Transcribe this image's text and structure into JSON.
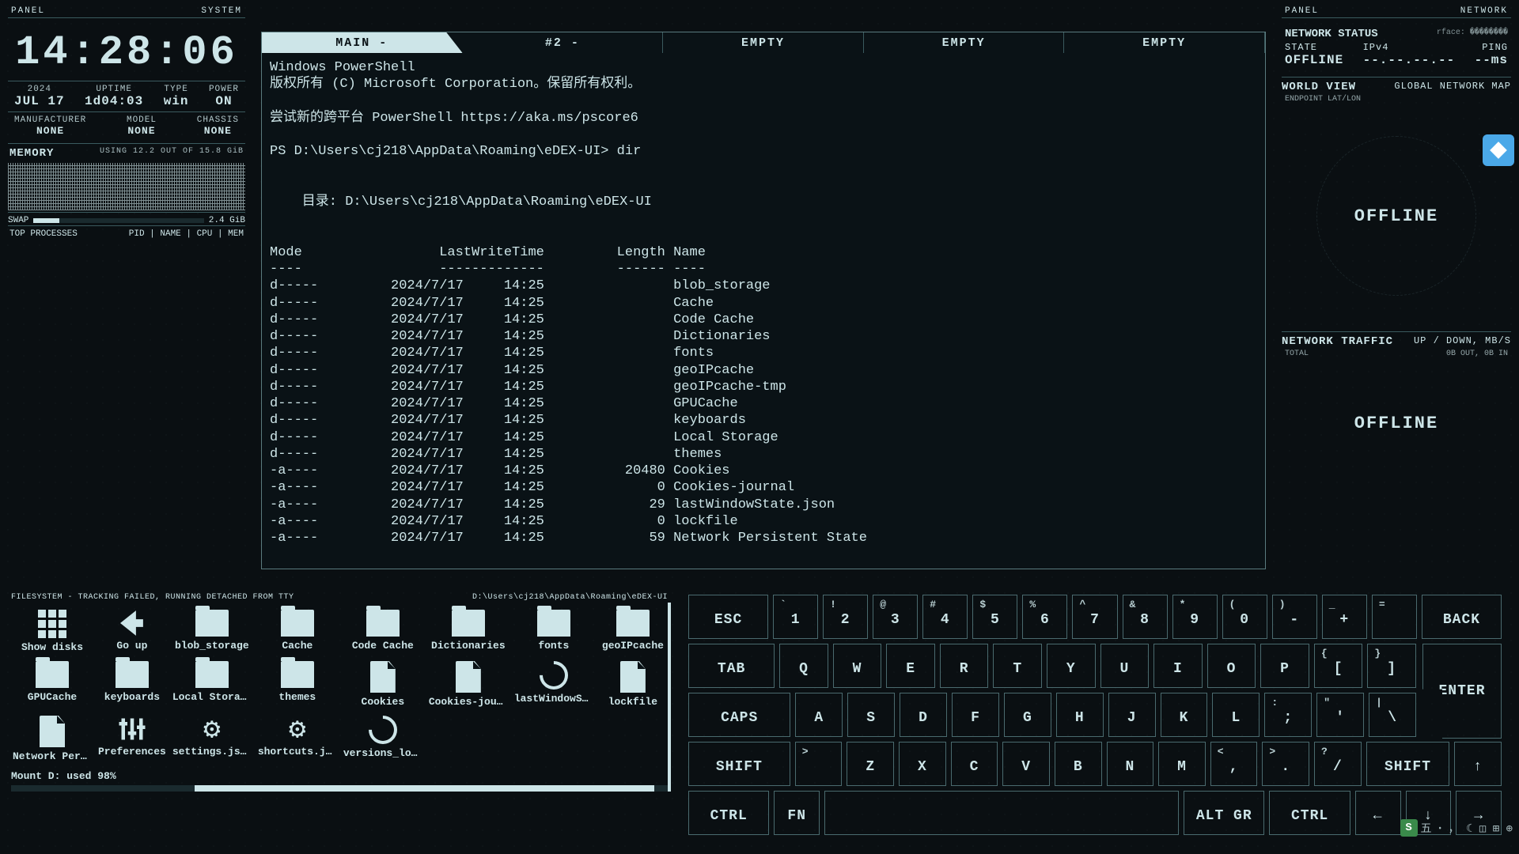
{
  "left": {
    "panel_label": "PANEL",
    "panel_type": "SYSTEM",
    "clock": "14:28:06",
    "year": "2024",
    "date": "JUL 17",
    "uptime_label": "UPTIME",
    "uptime": "1d04:03",
    "type_label": "TYPE",
    "type": "win",
    "power_label": "POWER",
    "power": "ON",
    "manufacturer_label": "MANUFACTURER",
    "manufacturer": "NONE",
    "model_label": "MODEL",
    "model": "NONE",
    "chassis_label": "CHASSIS",
    "chassis": "NONE",
    "memory_label": "MEMORY",
    "memory_usage": "USING 12.2 OUT OF 15.8 GiB",
    "swap_label": "SWAP",
    "swap_value": "2.4 GiB",
    "top_proc_label": "TOP PROCESSES",
    "top_proc_cols": "PID | NAME | CPU | MEM"
  },
  "tabs": [
    "MAIN -",
    "#2 -",
    "EMPTY",
    "EMPTY",
    "EMPTY"
  ],
  "terminal": "Windows PowerShell\n版权所有 (C) Microsoft Corporation。保留所有权利。\n\n尝试新的跨平台 PowerShell https://aka.ms/pscore6\n\nPS D:\\Users\\cj218\\AppData\\Roaming\\eDEX-UI> dir\n\n\n    目录: D:\\Users\\cj218\\AppData\\Roaming\\eDEX-UI\n\n\nMode                 LastWriteTime         Length Name\n----                 -------------         ------ ----\nd-----         2024/7/17     14:25                blob_storage\nd-----         2024/7/17     14:25                Cache\nd-----         2024/7/17     14:25                Code Cache\nd-----         2024/7/17     14:25                Dictionaries\nd-----         2024/7/17     14:25                fonts\nd-----         2024/7/17     14:25                geoIPcache\nd-----         2024/7/17     14:25                geoIPcache-tmp\nd-----         2024/7/17     14:25                GPUCache\nd-----         2024/7/17     14:25                keyboards\nd-----         2024/7/17     14:25                Local Storage\nd-----         2024/7/17     14:25                themes\n-a----         2024/7/17     14:25          20480 Cookies\n-a----         2024/7/17     14:25              0 Cookies-journal\n-a----         2024/7/17     14:25             29 lastWindowState.json\n-a----         2024/7/17     14:25              0 lockfile\n-a----         2024/7/17     14:25             59 Network Persistent State",
  "right": {
    "panel_label": "PANEL",
    "panel_type": "NETWORK",
    "status_title": "NETWORK STATUS",
    "iface": "rface: ��������",
    "state_label": "STATE",
    "state": "OFFLINE",
    "ipv4_label": "IPv4",
    "ipv4": "--.--.--.--",
    "ping_label": "PING",
    "ping": "--ms",
    "world_label": "WORLD VIEW",
    "world_sub": "GLOBAL NETWORK MAP",
    "endpoint": "ENDPOINT LAT/LON",
    "offline": "OFFLINE",
    "traffic_label": "NETWORK TRAFFIC",
    "traffic_sub": "UP / DOWN, MB/S",
    "total_label": "TOTAL",
    "total_sub": "0B OUT, 0B IN"
  },
  "fs": {
    "header_left": "FILESYSTEM - TRACKING FAILED, RUNNING DETACHED FROM TTY",
    "header_right": "D:\\Users\\cj218\\AppData\\Roaming\\eDEX-UI",
    "items": [
      {
        "label": "Show disks",
        "icon": "disks"
      },
      {
        "label": "Go up",
        "icon": "goup"
      },
      {
        "label": "blob_storage",
        "icon": "folder"
      },
      {
        "label": "Cache",
        "icon": "folder"
      },
      {
        "label": "Code Cache",
        "icon": "folder"
      },
      {
        "label": "Dictionaries",
        "icon": "folder"
      },
      {
        "label": "fonts",
        "icon": "folder"
      },
      {
        "label": "geoIPcache",
        "icon": "folder"
      },
      {
        "label": "GPUCache",
        "icon": "folder"
      },
      {
        "label": "keyboards",
        "icon": "folder"
      },
      {
        "label": "Local Storage",
        "icon": "folder"
      },
      {
        "label": "themes",
        "icon": "folder"
      },
      {
        "label": "Cookies",
        "icon": "file"
      },
      {
        "label": "Cookies-jour...",
        "icon": "file"
      },
      {
        "label": "lastWindowS...",
        "icon": "swirl"
      },
      {
        "label": "lockfile",
        "icon": "file"
      },
      {
        "label": "Network Pers...",
        "icon": "file"
      },
      {
        "label": "Preferences",
        "icon": "sliders"
      },
      {
        "label": "settings.json",
        "icon": "gear"
      },
      {
        "label": "shortcuts.json",
        "icon": "gear"
      },
      {
        "label": "versions_log...",
        "icon": "swirl"
      }
    ],
    "footer": "Mount D: used 98%"
  },
  "keyboard": {
    "row1": [
      {
        "m": "ESC",
        "w": "wide"
      },
      {
        "s": "`",
        "m": "1"
      },
      {
        "s": "!",
        "m": "2"
      },
      {
        "s": "@",
        "m": "3"
      },
      {
        "s": "#",
        "m": "4"
      },
      {
        "s": "$",
        "m": "5"
      },
      {
        "s": "%",
        "m": "6"
      },
      {
        "s": "^",
        "m": "7"
      },
      {
        "s": "&",
        "m": "8"
      },
      {
        "s": "*",
        "m": "9"
      },
      {
        "s": "(",
        "m": "0"
      },
      {
        "s": ")",
        "m": "-"
      },
      {
        "s": "_",
        "m": "+"
      },
      {
        "s": "=",
        "m": ""
      },
      {
        "m": "BACK",
        "w": "wide"
      }
    ],
    "row2": [
      {
        "m": "TAB",
        "w": "wide"
      },
      {
        "m": "Q"
      },
      {
        "m": "W"
      },
      {
        "m": "E"
      },
      {
        "m": "R"
      },
      {
        "m": "T"
      },
      {
        "m": "Y"
      },
      {
        "m": "U"
      },
      {
        "m": "I"
      },
      {
        "m": "O"
      },
      {
        "m": "P"
      },
      {
        "s": "{",
        "m": "["
      },
      {
        "s": "}",
        "m": "]"
      }
    ],
    "enter": "ENTER",
    "row3": [
      {
        "m": "CAPS",
        "w": "wider"
      },
      {
        "m": "A"
      },
      {
        "m": "S"
      },
      {
        "m": "D"
      },
      {
        "m": "F"
      },
      {
        "m": "G"
      },
      {
        "m": "H"
      },
      {
        "m": "J"
      },
      {
        "m": "K"
      },
      {
        "m": "L"
      },
      {
        "s": ":",
        "m": ";"
      },
      {
        "s": "\"",
        "m": "'"
      },
      {
        "s": "|",
        "m": "\\"
      }
    ],
    "row4": [
      {
        "m": "SHIFT",
        "w": "wider"
      },
      {
        "s": ">",
        "m": ""
      },
      {
        "m": "Z"
      },
      {
        "m": "X"
      },
      {
        "m": "C"
      },
      {
        "m": "V"
      },
      {
        "m": "B"
      },
      {
        "m": "N"
      },
      {
        "m": "M"
      },
      {
        "s": "<",
        "m": ","
      },
      {
        "s": ">",
        "m": "."
      },
      {
        "s": "?",
        "m": "/"
      },
      {
        "m": "SHIFT",
        "w": "wide"
      },
      {
        "m": "↑"
      }
    ],
    "row5": [
      {
        "m": "CTRL",
        "w": "wide"
      },
      {
        "m": "FN"
      },
      {
        "m": "",
        "w": "space"
      },
      {
        "m": "ALT GR",
        "w": "wide"
      },
      {
        "m": "CTRL",
        "w": "wide"
      },
      {
        "m": "←"
      },
      {
        "m": "↓"
      },
      {
        "m": "→"
      }
    ]
  },
  "ime": {
    "indicator": "S",
    "text": "五 ꞏ ， ☾ ◫ ⊞ ⊕"
  }
}
